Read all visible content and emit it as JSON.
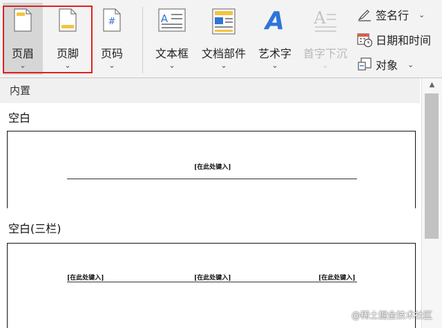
{
  "ribbon": {
    "header": {
      "label": "页眉",
      "chevron": "⌄"
    },
    "footer": {
      "label": "页脚",
      "chevron": "⌄"
    },
    "page_number": {
      "label": "页码",
      "chevron": "⌄",
      "glyph": "#"
    },
    "text_box": {
      "label": "文本框",
      "chevron": "⌄",
      "glyph": "A"
    },
    "doc_parts": {
      "label": "文档部件",
      "chevron": "⌄"
    },
    "wordart": {
      "label": "艺术字",
      "chevron": "⌄",
      "glyph": "A"
    },
    "drop_cap": {
      "label": "首字下沉",
      "chevron": "⌄",
      "glyph": "A",
      "disabled": true
    },
    "signature": {
      "label": "签名行",
      "chevron": "⌄"
    },
    "date_time": {
      "label": "日期和时间"
    },
    "object": {
      "label": "对象",
      "chevron": "⌄"
    }
  },
  "gallery": {
    "category": "内置",
    "items": [
      {
        "title": "空白",
        "placeholders": [
          "[在此处键入]"
        ]
      },
      {
        "title": "空白(三栏)",
        "placeholders": [
          "[在此处键入]",
          "[在此处键入]",
          "[在此处键入]"
        ]
      }
    ]
  },
  "watermark": "@稀土掘金技术社区",
  "colors": {
    "highlight_border": "#e02020",
    "wordart_blue": "#2e75d6",
    "icon_yellow": "#f5c242"
  }
}
